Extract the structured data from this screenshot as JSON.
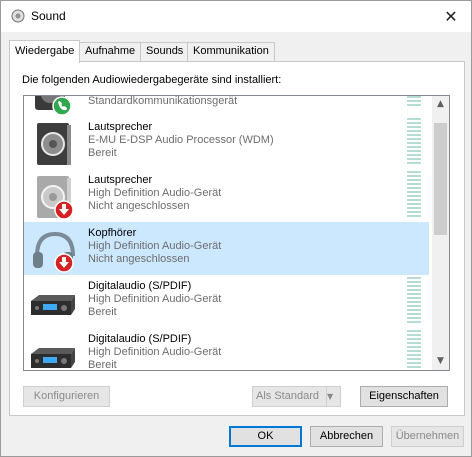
{
  "window": {
    "title": "Sound",
    "close_glyph": "✕"
  },
  "tabs": [
    {
      "label": "Wiedergabe",
      "active": true
    },
    {
      "label": "Aufnahme",
      "active": false
    },
    {
      "label": "Sounds",
      "active": false
    },
    {
      "label": "Kommunikation",
      "active": false
    }
  ],
  "panel": {
    "label": "Die folgenden Audiowiedergabegeräte sind installiert:"
  },
  "devices": [
    {
      "name": "Standardkommunikationsgerät",
      "description": "",
      "status": "",
      "icon": "speaker-with-phone-badge-icon",
      "badge": "green-phone"
    },
    {
      "name": "Lautsprecher",
      "description": "E-MU E-DSP Audio Processor (WDM)",
      "status": "Bereit",
      "icon": "speaker-icon",
      "badge": "none"
    },
    {
      "name": "Lautsprecher",
      "description": "High Definition Audio-Gerät",
      "status": "Nicht angeschlossen",
      "icon": "speaker-disconnected-icon",
      "badge": "red-down-arrow"
    },
    {
      "name": "Kopfhörer",
      "description": "High Definition Audio-Gerät",
      "status": "Nicht angeschlossen",
      "icon": "headphones-disconnected-icon",
      "badge": "red-down-arrow",
      "selected": true
    },
    {
      "name": "Digitalaudio (S/PDIF)",
      "description": "High Definition Audio-Gerät",
      "status": "Bereit",
      "icon": "digital-audio-receiver-icon",
      "badge": "none"
    },
    {
      "name": "Digitalaudio (S/PDIF)",
      "description": "High Definition Audio-Gerät",
      "status": "Bereit",
      "icon": "digital-audio-receiver-icon",
      "badge": "none"
    }
  ],
  "buttons": {
    "configure": "Konfigurieren",
    "set_default": "Als Standard",
    "properties": "Eigenschaften",
    "ok": "OK",
    "cancel": "Abbrechen",
    "apply": "Übernehmen"
  },
  "colors": {
    "selection": "#cce8ff",
    "meter": "#b5ddd5",
    "accent": "#0078d7"
  }
}
